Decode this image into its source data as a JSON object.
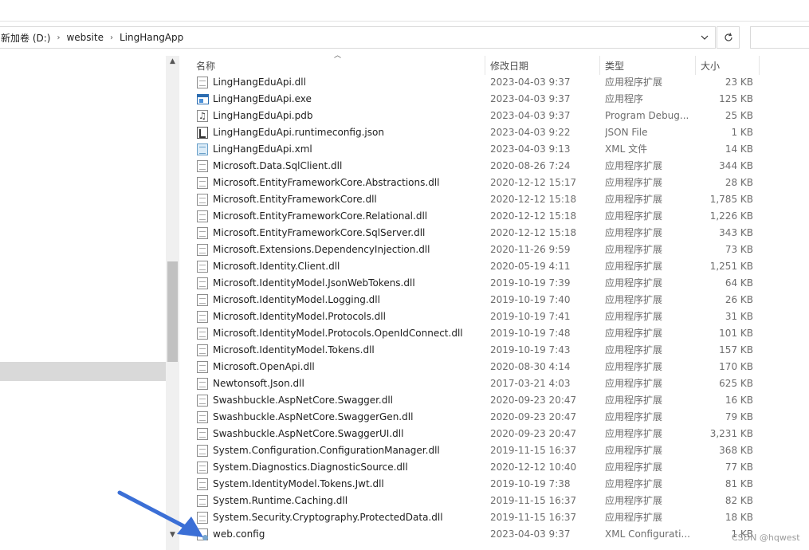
{
  "breadcrumb": {
    "items": [
      "新加卷 (D:)",
      "website",
      "LingHangApp"
    ],
    "separator": "›"
  },
  "addressbar": {
    "dropdown_icon": "chevron-down-icon",
    "refresh_icon": "refresh-icon"
  },
  "columns": {
    "name": "名称",
    "date": "修改日期",
    "type": "类型",
    "size": "大小"
  },
  "files": [
    {
      "name": "LingHangEduApi.dll",
      "date": "2023-04-03 9:37",
      "type": "应用程序扩展",
      "size": "23 KB",
      "icon": "dll-icon"
    },
    {
      "name": "LingHangEduApi.exe",
      "date": "2023-04-03 9:37",
      "type": "应用程序",
      "size": "125 KB",
      "icon": "exe-icon"
    },
    {
      "name": "LingHangEduApi.pdb",
      "date": "2023-04-03 9:37",
      "type": "Program Debug...",
      "size": "25 KB",
      "icon": "pdb-icon"
    },
    {
      "name": "LingHangEduApi.runtimeconfig.json",
      "date": "2023-04-03 9:22",
      "type": "JSON File",
      "size": "1 KB",
      "icon": "json-icon"
    },
    {
      "name": "LingHangEduApi.xml",
      "date": "2023-04-03 9:13",
      "type": "XML 文件",
      "size": "14 KB",
      "icon": "xml-icon"
    },
    {
      "name": "Microsoft.Data.SqlClient.dll",
      "date": "2020-08-26 7:24",
      "type": "应用程序扩展",
      "size": "344 KB",
      "icon": "dll-icon"
    },
    {
      "name": "Microsoft.EntityFrameworkCore.Abstractions.dll",
      "date": "2020-12-12 15:17",
      "type": "应用程序扩展",
      "size": "28 KB",
      "icon": "dll-icon"
    },
    {
      "name": "Microsoft.EntityFrameworkCore.dll",
      "date": "2020-12-12 15:18",
      "type": "应用程序扩展",
      "size": "1,785 KB",
      "icon": "dll-icon"
    },
    {
      "name": "Microsoft.EntityFrameworkCore.Relational.dll",
      "date": "2020-12-12 15:18",
      "type": "应用程序扩展",
      "size": "1,226 KB",
      "icon": "dll-icon"
    },
    {
      "name": "Microsoft.EntityFrameworkCore.SqlServer.dll",
      "date": "2020-12-12 15:18",
      "type": "应用程序扩展",
      "size": "343 KB",
      "icon": "dll-icon"
    },
    {
      "name": "Microsoft.Extensions.DependencyInjection.dll",
      "date": "2020-11-26 9:59",
      "type": "应用程序扩展",
      "size": "73 KB",
      "icon": "dll-icon"
    },
    {
      "name": "Microsoft.Identity.Client.dll",
      "date": "2020-05-19 4:11",
      "type": "应用程序扩展",
      "size": "1,251 KB",
      "icon": "dll-icon"
    },
    {
      "name": "Microsoft.IdentityModel.JsonWebTokens.dll",
      "date": "2019-10-19 7:39",
      "type": "应用程序扩展",
      "size": "64 KB",
      "icon": "dll-icon"
    },
    {
      "name": "Microsoft.IdentityModel.Logging.dll",
      "date": "2019-10-19 7:40",
      "type": "应用程序扩展",
      "size": "26 KB",
      "icon": "dll-icon"
    },
    {
      "name": "Microsoft.IdentityModel.Protocols.dll",
      "date": "2019-10-19 7:41",
      "type": "应用程序扩展",
      "size": "31 KB",
      "icon": "dll-icon"
    },
    {
      "name": "Microsoft.IdentityModel.Protocols.OpenIdConnect.dll",
      "date": "2019-10-19 7:48",
      "type": "应用程序扩展",
      "size": "101 KB",
      "icon": "dll-icon"
    },
    {
      "name": "Microsoft.IdentityModel.Tokens.dll",
      "date": "2019-10-19 7:43",
      "type": "应用程序扩展",
      "size": "157 KB",
      "icon": "dll-icon"
    },
    {
      "name": "Microsoft.OpenApi.dll",
      "date": "2020-08-30 4:14",
      "type": "应用程序扩展",
      "size": "170 KB",
      "icon": "dll-icon"
    },
    {
      "name": "Newtonsoft.Json.dll",
      "date": "2017-03-21 4:03",
      "type": "应用程序扩展",
      "size": "625 KB",
      "icon": "dll-icon"
    },
    {
      "name": "Swashbuckle.AspNetCore.Swagger.dll",
      "date": "2020-09-23 20:47",
      "type": "应用程序扩展",
      "size": "16 KB",
      "icon": "dll-icon"
    },
    {
      "name": "Swashbuckle.AspNetCore.SwaggerGen.dll",
      "date": "2020-09-23 20:47",
      "type": "应用程序扩展",
      "size": "79 KB",
      "icon": "dll-icon"
    },
    {
      "name": "Swashbuckle.AspNetCore.SwaggerUI.dll",
      "date": "2020-09-23 20:47",
      "type": "应用程序扩展",
      "size": "3,231 KB",
      "icon": "dll-icon"
    },
    {
      "name": "System.Configuration.ConfigurationManager.dll",
      "date": "2019-11-15 16:37",
      "type": "应用程序扩展",
      "size": "368 KB",
      "icon": "dll-icon"
    },
    {
      "name": "System.Diagnostics.DiagnosticSource.dll",
      "date": "2020-12-12 10:40",
      "type": "应用程序扩展",
      "size": "77 KB",
      "icon": "dll-icon"
    },
    {
      "name": "System.IdentityModel.Tokens.Jwt.dll",
      "date": "2019-10-19 7:38",
      "type": "应用程序扩展",
      "size": "81 KB",
      "icon": "dll-icon"
    },
    {
      "name": "System.Runtime.Caching.dll",
      "date": "2019-11-15 16:37",
      "type": "应用程序扩展",
      "size": "82 KB",
      "icon": "dll-icon"
    },
    {
      "name": "System.Security.Cryptography.ProtectedData.dll",
      "date": "2019-11-15 16:37",
      "type": "应用程序扩展",
      "size": "18 KB",
      "icon": "dll-icon"
    },
    {
      "name": "web.config",
      "date": "2023-04-03 9:37",
      "type": "XML Configurati...",
      "size": "1 KB",
      "icon": "config-icon"
    }
  ],
  "annotation": {
    "icon": "pointer-arrow-icon",
    "color": "#3b6fd6"
  },
  "watermark": "CSDN @hqwest"
}
